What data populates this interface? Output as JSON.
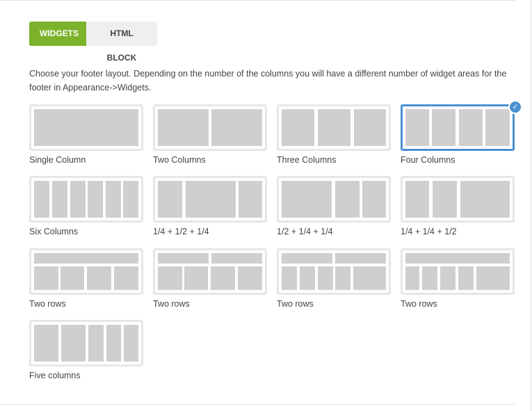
{
  "tabs": {
    "widgets": "WIDGETS",
    "html_block": "HTML BLOCK"
  },
  "description": "Choose your footer layout. Depending on the number of the columns you will have a different number of widget areas for the footer in Appearance->Widgets.",
  "layouts": [
    {
      "label": "Single Column"
    },
    {
      "label": "Two Columns"
    },
    {
      "label": "Three Columns"
    },
    {
      "label": "Four Columns",
      "selected": true
    },
    {
      "label": "Six Columns"
    },
    {
      "label": "1/4 + 1/2 + 1/4"
    },
    {
      "label": "1/2 + 1/4 + 1/4"
    },
    {
      "label": "1/4 + 1/4 + 1/2"
    },
    {
      "label": "Two rows"
    },
    {
      "label": "Two rows"
    },
    {
      "label": "Two rows"
    },
    {
      "label": "Two rows"
    },
    {
      "label": "Five columns"
    }
  ],
  "colors": {
    "accent": "#7cb32b",
    "selected_border": "#4a90d2",
    "block": "#cfcfcf"
  },
  "icons": {
    "selected_badge": "check-icon"
  }
}
